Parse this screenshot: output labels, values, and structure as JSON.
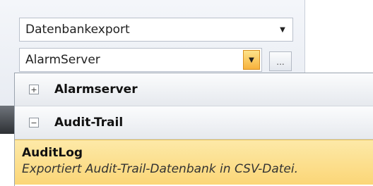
{
  "export_type_combo": {
    "value": "Datenbankexport",
    "arrow_icon": "chevron-down-icon"
  },
  "server_combo": {
    "value": "AlarmServer",
    "arrow_icon": "chevron-down-icon"
  },
  "browse_button": {
    "label": "..."
  },
  "dropdown": {
    "groups": [
      {
        "label": "Alarmserver",
        "toggle": "⊞",
        "expanded": false
      },
      {
        "label": "Audit-Trail",
        "toggle": "⊟",
        "expanded": true
      }
    ],
    "selected_item": {
      "title": "AuditLog",
      "description": "Exportiert Audit-Trail-Datenbank in CSV-Datei."
    }
  },
  "colors": {
    "selection": "#fbd677",
    "dropdown_button": "#f7b23c"
  }
}
